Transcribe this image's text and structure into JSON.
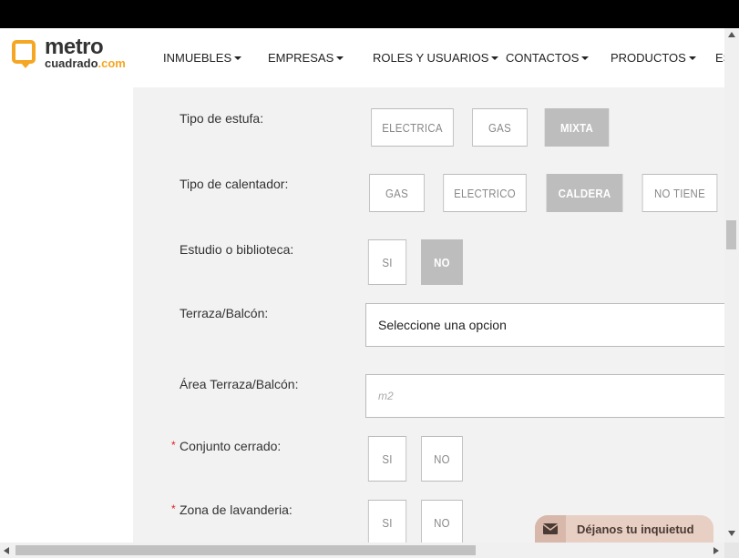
{
  "brand": {
    "line1": "metro",
    "line2_a": "cuadrado",
    "line2_b": ".com"
  },
  "nav": {
    "items": [
      "INMUEBLES",
      "EMPRESAS",
      "ROLES Y USUARIOS",
      "CONTACTOS",
      "PRODUCTOS",
      "ES"
    ]
  },
  "form": {
    "estufa": {
      "label": "Tipo de estufa:",
      "options": [
        "ELECTRICA",
        "GAS",
        "MIXTA"
      ],
      "selected": "MIXTA"
    },
    "calentador": {
      "label": "Tipo de calentador:",
      "options": [
        "GAS",
        "ELECTRICO",
        "CALDERA",
        "NO TIENE"
      ],
      "selected": "CALDERA"
    },
    "estudio": {
      "label": "Estudio o biblioteca:",
      "options": [
        "SI",
        "NO"
      ],
      "selected": "NO"
    },
    "terraza": {
      "label": "Terraza/Balcón:",
      "value": "Seleccione una opcion"
    },
    "area_terraza": {
      "label": "Área Terraza/Balcón:",
      "placeholder": "m2"
    },
    "conjunto": {
      "label": "Conjunto cerrado:",
      "required_mark": "*",
      "options": [
        "SI",
        "NO"
      ]
    },
    "lavanderia": {
      "label": "Zona de lavanderia:",
      "required_mark": "*",
      "options": [
        "SI",
        "NO"
      ]
    }
  },
  "chat": {
    "label": "Déjanos tu inquietud",
    "icon": "envelope-icon"
  },
  "colors": {
    "accent": "#f5a623",
    "selected_option": "#bdbdbd",
    "topbar": "#000000"
  }
}
